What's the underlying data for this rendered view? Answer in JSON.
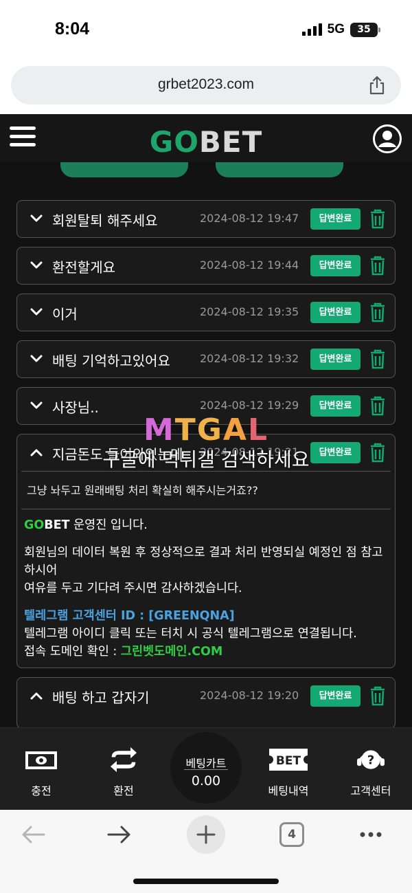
{
  "status_bar": {
    "time": "8:04",
    "network": "5G",
    "battery": "35"
  },
  "browser": {
    "url": "grbet2023.com",
    "tab_count": "4"
  },
  "header": {
    "logo_go": "GO",
    "logo_bet": "BET"
  },
  "inquiries": [
    {
      "title": "회원탈퇴 해주세요",
      "date": "2024-08-12 19:47",
      "status": "답변완료",
      "expanded": false
    },
    {
      "title": "환전할게요",
      "date": "2024-08-12 19:44",
      "status": "답변완료",
      "expanded": false
    },
    {
      "title": "이거",
      "date": "2024-08-12 19:35",
      "status": "답변완료",
      "expanded": false
    },
    {
      "title": "배팅 기억하고있어요",
      "date": "2024-08-12 19:32",
      "status": "답변완료",
      "expanded": false
    },
    {
      "title": "사장님..",
      "date": "2024-08-12 19:29",
      "status": "답변완료",
      "expanded": false
    },
    {
      "title": "지금돈도 들어와있는데",
      "date": "2024-08-12 19:21",
      "status": "답변완료",
      "expanded": true
    },
    {
      "title": "배팅 하고 갑자기",
      "date": "2024-08-12 19:20",
      "status": "답변완료",
      "expanded": true
    }
  ],
  "expanded_inquiry": {
    "question": "그냥 놔두고 원래배팅 처리 확실히 해주시는거죠??",
    "answer_brand_go": "GO",
    "answer_brand_bet": "BET",
    "answer_intro": " 운영진 입니다.",
    "answer_body_1": "회원님의 데이터 복원 후 정상적으로 결과 처리 반영되실 예정인 점 참고하시어",
    "answer_body_2": "여유를 두고 기다려 주시면 감사하겠습니다.",
    "telegram_title": "텔레그램 고객센터 ID : [GREENQNA]",
    "telegram_desc": "텔레그램 아이디 클릭 또는 터치 시 공식 텔레그램으로 연결됩니다.",
    "domain_label": "접속 도메인 확인 : ",
    "domain_link": "그린벳도메인.COM"
  },
  "watermark": {
    "logo": "MTGAL",
    "text": "구글에 먹튀갤 검색하세요"
  },
  "bottom_nav": {
    "charge": "충전",
    "exchange": "환전",
    "cart_title": "베팅카트",
    "cart_value": "0.00",
    "bet_history": "베팅내역",
    "bet_icon_text": "BET",
    "support": "고객센터"
  },
  "colors": {
    "accent_green": "#14a874",
    "background": "#121212",
    "link_blue": "#4aa3e0"
  }
}
